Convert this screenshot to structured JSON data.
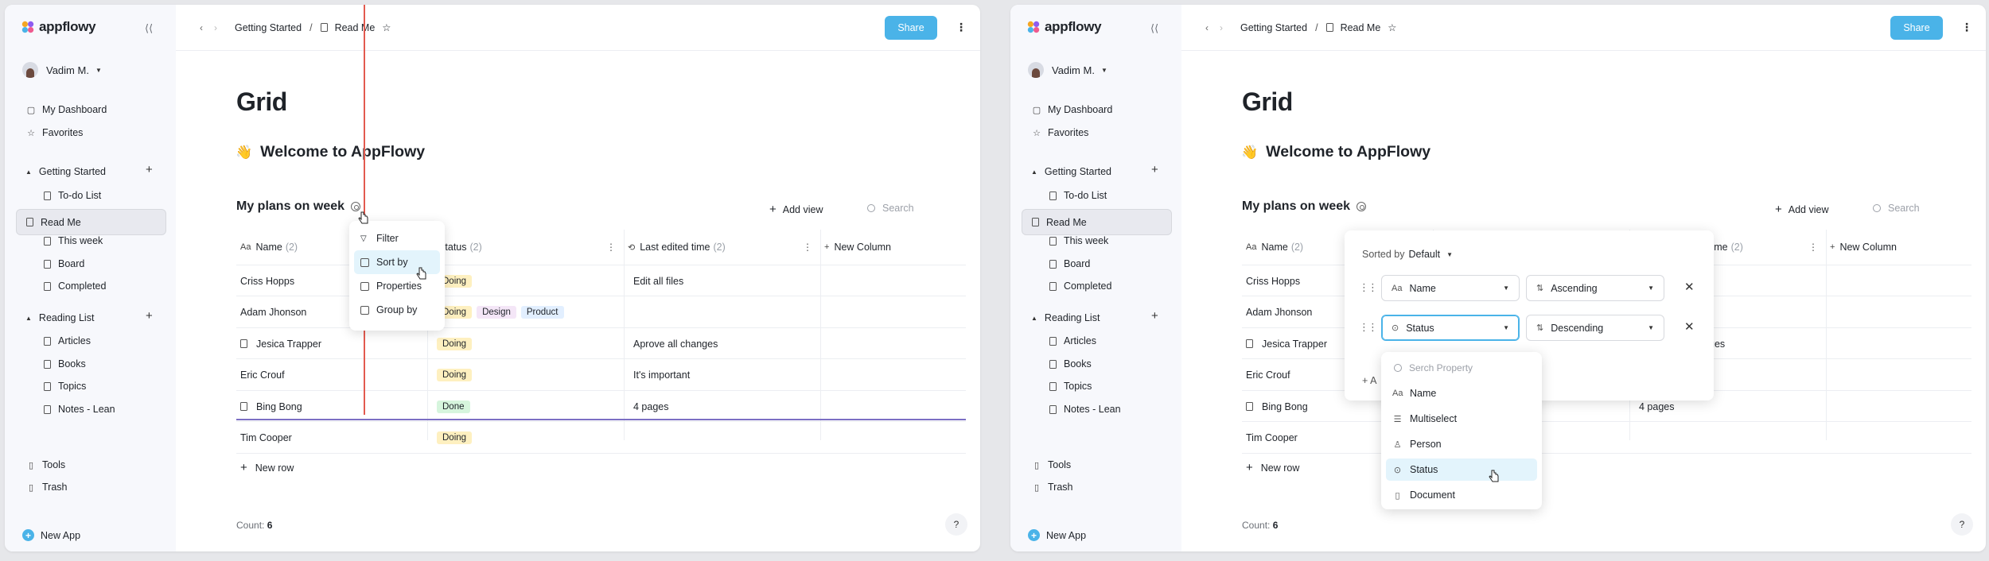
{
  "app": {
    "logo_text": "appflowy",
    "user_name": "Vadim M.",
    "nav": {
      "dashboard": "My Dashboard",
      "favorites": "Favorites"
    },
    "sections": [
      {
        "title": "Getting Started",
        "items": [
          "To-do List",
          "Read Me",
          "This week",
          "Board",
          "Completed"
        ]
      },
      {
        "title": "Reading List",
        "items": [
          "Articles",
          "Books",
          "Topics",
          "Notes - Lean"
        ]
      }
    ],
    "bottom": {
      "tools": "Tools",
      "trash": "Trash",
      "new_app": "New App"
    },
    "breadcrumb": {
      "parent": "Getting Started",
      "separator": "/",
      "current": "Read Me"
    },
    "share_label": "Share",
    "page_title": "Grid",
    "welcome": "Welcome to AppFlowy",
    "welcome_emoji": "👋",
    "db_title": "My plans on week",
    "add_view": "Add view",
    "search_placeholder": "Search",
    "columns": [
      {
        "label": "Name",
        "count": "(2)"
      },
      {
        "label": "Status",
        "count": "(2)"
      },
      {
        "label": "Last edited time",
        "count": "(2)"
      },
      {
        "label": "New Column"
      }
    ],
    "rows": [
      {
        "name": "Criss Hopps",
        "tags": [
          "Doing"
        ],
        "edited": "Edit all files",
        "icon": false
      },
      {
        "name": "Adam Jhonson",
        "tags": [
          "Doing",
          "Design",
          "Product"
        ],
        "edited": "",
        "icon": false
      },
      {
        "name": "Jesica Trapper",
        "tags": [
          "Doing"
        ],
        "edited": "Aprove all changes",
        "icon": true
      },
      {
        "name": "Eric Crouf",
        "tags": [
          "Doing"
        ],
        "edited": "It's important",
        "icon": false
      },
      {
        "name": "Bing Bong",
        "tags": [
          "Done"
        ],
        "edited": "4 pages",
        "icon": true
      },
      {
        "name": "Tim Cooper",
        "tags": [
          "Doing"
        ],
        "edited": "",
        "icon": false
      }
    ],
    "new_row": "New row",
    "count_label": "Count:",
    "count_value": "6",
    "help": "?"
  },
  "left_menu": {
    "items": [
      "Filter",
      "Sort by",
      "Properties",
      "Group by"
    ],
    "highlighted": "Sort by"
  },
  "sort_panel": {
    "sorted_by_label": "Sorted by",
    "sorted_by_value": "Default",
    "rules": [
      {
        "field": "Name",
        "order": "Ascending"
      },
      {
        "field": "Status",
        "order": "Descending"
      }
    ],
    "add_sort_fragment": "+ A",
    "right_fragments": {
      "header": "time",
      "edited_row3": "ges",
      "edited_row5": "4 pages"
    }
  },
  "property_menu": {
    "search_placeholder": "Serch Property",
    "items": [
      {
        "label": "Name",
        "icon": "text-icon"
      },
      {
        "label": "Multiselect",
        "icon": "list-icon"
      },
      {
        "label": "Person",
        "icon": "person-icon"
      },
      {
        "label": "Status",
        "icon": "status-icon"
      },
      {
        "label": "Document",
        "icon": "document-icon"
      }
    ],
    "highlighted": "Status"
  },
  "colors": {
    "accent": "#4ab3e8",
    "doing": "#fef0c0",
    "done": "#d6f5dd",
    "design": "#f4e6f7",
    "product": "#e2efff",
    "drop_line_red": "#e35a4f",
    "drop_line_purple": "#7c6fc4"
  }
}
